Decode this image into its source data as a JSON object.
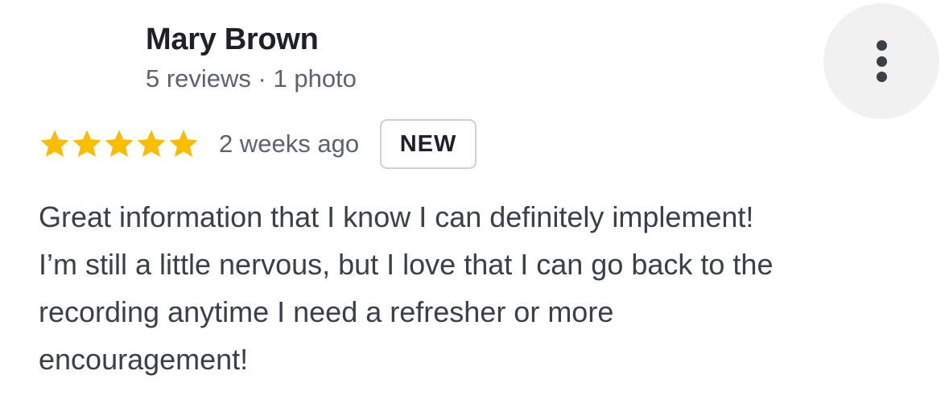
{
  "reviewer": {
    "name": "Mary Brown",
    "meta": "5 reviews · 1 photo"
  },
  "more_button": {
    "icon": "more-vertical-icon"
  },
  "rating": {
    "stars": 5,
    "max_stars": 5,
    "star_color": "#fbbc04",
    "time_ago": "2 weeks ago",
    "badge": "NEW"
  },
  "review": {
    "lines": [
      "Great information that I know I can definitely implement!",
      "I’m still a little nervous, but I love that I can go back to the",
      "recording anytime I need a refresher or more",
      "encouragement!"
    ]
  }
}
